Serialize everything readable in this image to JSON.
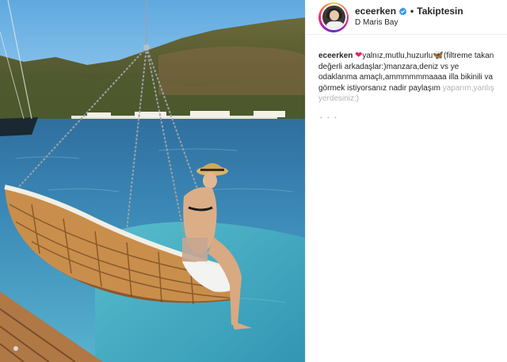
{
  "post": {
    "author": {
      "username": "eceerken",
      "verified": true,
      "follow_label": "Takiptesin",
      "location": "D Maris Bay"
    },
    "caption": {
      "username": "eceerken",
      "heart": "❤",
      "words": "yalnız,mutlu,huzurlu",
      "butterfly": "🦋",
      "body": "(filtreme takan değerli arkadaşlar:)manzara,deniz vs ye odaklanma amaçlı,ammmmmmaaaa illa bikinili va görmek istiyorsanız nadir paylaşım",
      "tail": "yaparım,yanlış yerdesiniz:)"
    },
    "icons": {
      "verified_badge": "verified-badge-icon",
      "avatar": "avatar",
      "photo": "swing-hammock-sea-photo"
    },
    "colors": {
      "verified_blue": "#3897f0",
      "heart_red": "#e0245e",
      "text": "#262626"
    }
  }
}
